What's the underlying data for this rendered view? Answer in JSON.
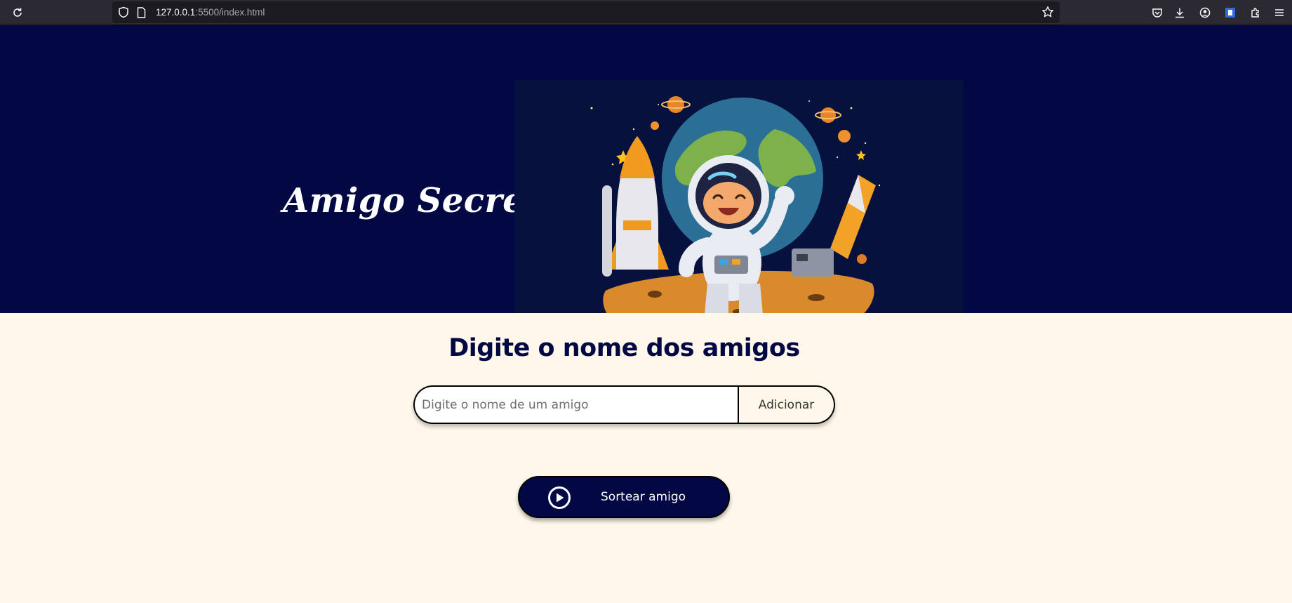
{
  "browser": {
    "url_host": "127.0.0.1",
    "url_rest": ":5500/index.html"
  },
  "hero": {
    "title": "Amigo Secreto",
    "background_color": "#020843"
  },
  "main": {
    "heading": "Digite o nome dos amigos",
    "background_color": "#fff8ea",
    "input_placeholder": "Digite o nome de um amigo",
    "input_value": "",
    "add_button_label": "Adicionar",
    "draw_button_label": "Sortear amigo",
    "draw_button_icon": "play-circle-icon"
  }
}
